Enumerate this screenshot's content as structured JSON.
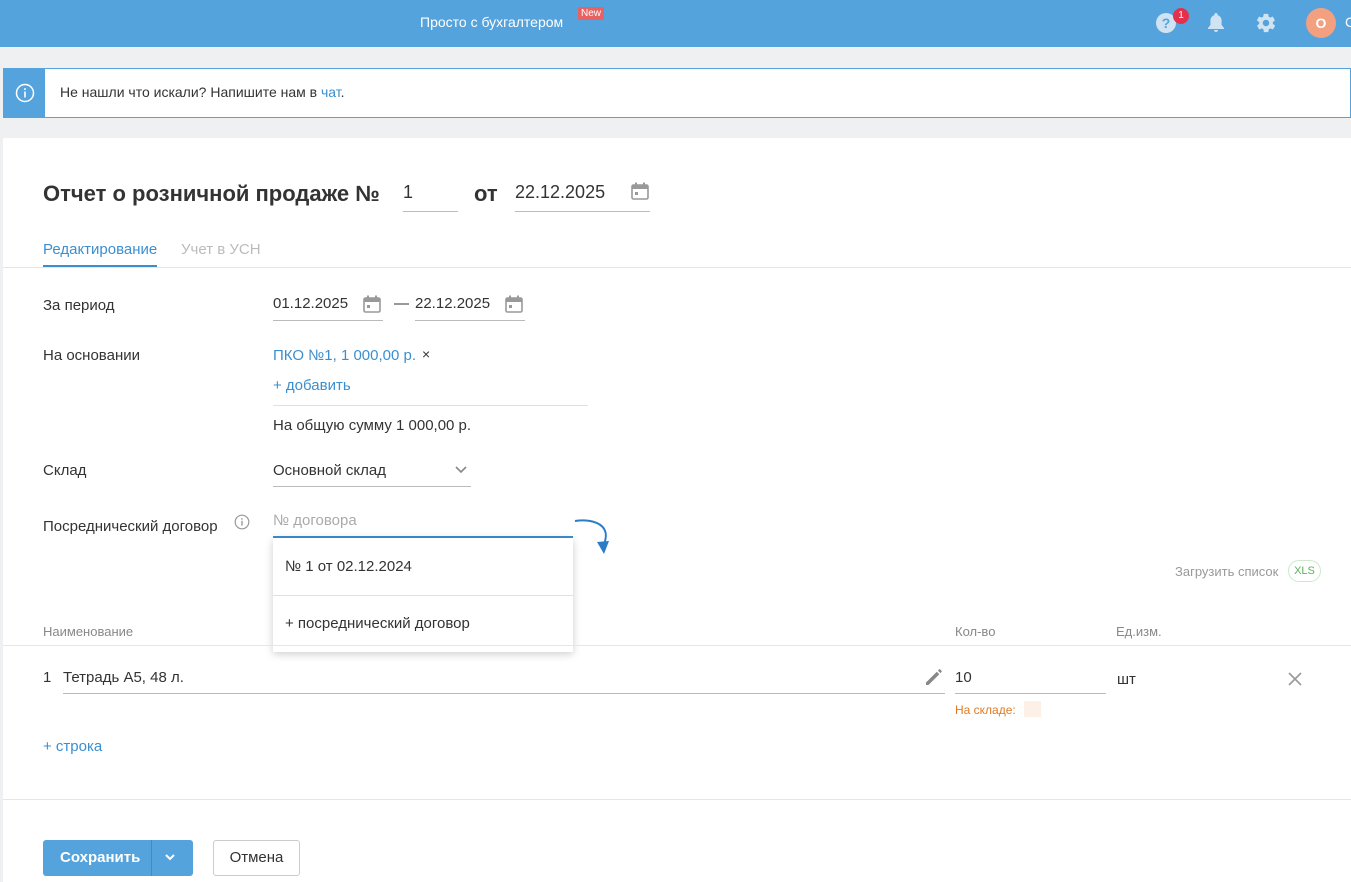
{
  "topbar": {
    "promo": "Просто с бухгалтером",
    "new_badge": "New",
    "help_count": "1",
    "avatar_letter": "О",
    "avatar_cut": "С"
  },
  "info": {
    "text": "Не нашли что искали? Напишите нам в ",
    "link": "чат",
    "period": "."
  },
  "header": {
    "title": "Отчет о розничной продаже №",
    "number": "1",
    "ot": "от",
    "date": "22.12.2025"
  },
  "tabs": [
    {
      "label": "Редактирование",
      "active": true
    },
    {
      "label": "Учет в УСН",
      "active": false
    }
  ],
  "form": {
    "period_label": "За период",
    "period_from": "01.12.2025",
    "period_dash": "—",
    "period_to": "22.12.2025",
    "basis_label": "На основании",
    "basis_doc": "ПКО №1, 1 000,00 р.",
    "basis_remove": "×",
    "basis_add": "+ добавить",
    "basis_total": "На общую сумму 1 000,00 р.",
    "warehouse_label": "Склад",
    "warehouse_value": "Основной склад",
    "agent_label": "Посреднический договор",
    "agent_placeholder": "№ договора"
  },
  "dropdown": {
    "option1": "№ 1 от 02.12.2024",
    "option2": "+ посреднический договор"
  },
  "table": {
    "load_list": "Загрузить список",
    "xls": "XLS",
    "col_name": "Наименование",
    "col_qty": "Кол-во",
    "col_unit": "Ед.изм.",
    "rows": [
      {
        "num": "1",
        "name": "Тетрадь А5, 48 л.",
        "qty": "10",
        "unit": "шт",
        "stock_label": "На складе:"
      }
    ],
    "add_row": "+ строка"
  },
  "footer": {
    "save": "Сохранить",
    "cancel": "Отмена"
  },
  "colors": {
    "accent": "#55a3dc",
    "link": "#3b8fd0",
    "warning": "#e07b22"
  }
}
